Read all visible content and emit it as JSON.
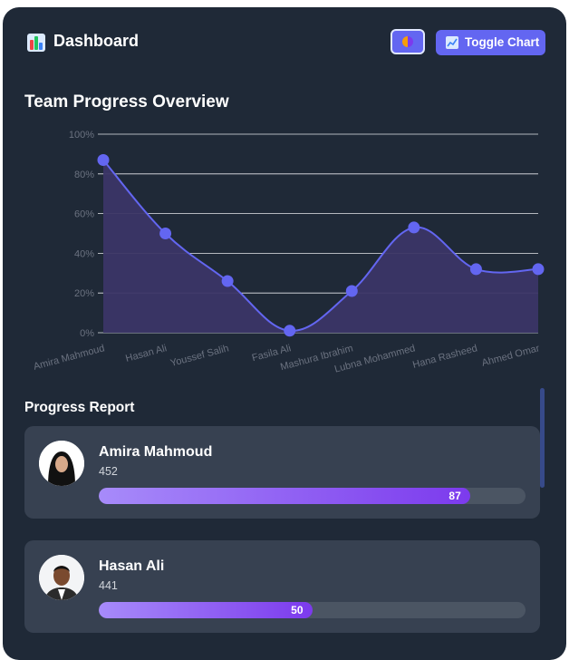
{
  "header": {
    "title": "Dashboard",
    "app_icon": "bar-chart-icon",
    "theme_icon": "theme-toggle-icon",
    "toggle_chart_label": "Toggle Chart",
    "toggle_chart_icon": "line-chart-icon"
  },
  "section_title": "Team Progress Overview",
  "chart_data": {
    "type": "area",
    "categories": [
      "Amira Mahmoud",
      "Hasan Ali",
      "Youssef Salih",
      "Fasila Ali",
      "Mashura Ibrahim",
      "Lubna Mohammed",
      "Hana Rasheed",
      "Ahmed Omar"
    ],
    "series": [
      {
        "values": [
          87,
          50,
          26,
          1,
          21,
          53,
          32,
          32
        ]
      }
    ],
    "y_ticks": [
      "0%",
      "20%",
      "40%",
      "60%",
      "80%",
      "100%"
    ],
    "ylim": [
      0,
      100
    ],
    "grid": true,
    "colors": {
      "line": "#6366f1",
      "fill": "#3b3566",
      "point": "#6366f1"
    }
  },
  "report": {
    "title": "Progress Report",
    "rows": [
      {
        "name": "Amira Mahmoud",
        "score": "452",
        "progress": 87,
        "progress_label": "87",
        "avatar": "avatar-hijab"
      },
      {
        "name": "Hasan Ali",
        "score": "441",
        "progress": 50,
        "progress_label": "50",
        "avatar": "avatar-man"
      }
    ]
  }
}
